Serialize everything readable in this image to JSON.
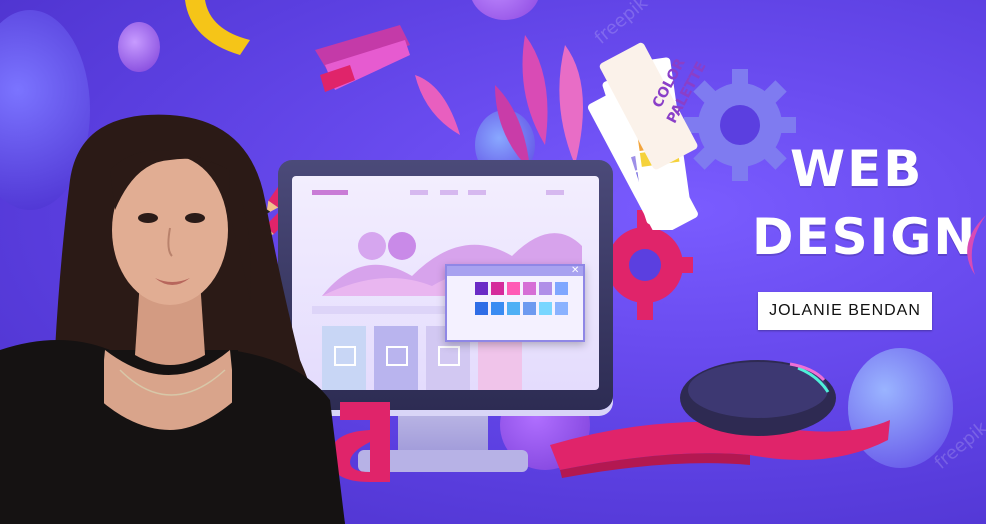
{
  "banner": {
    "title_line1": "WEB",
    "title_line2": "DESIGN",
    "author_name": "JOLANIE BENDAN"
  },
  "palette_card": {
    "text_line1": "COLOR",
    "text_line2": "PALETTE"
  },
  "watermark_text": "freepik",
  "colors": {
    "background": "#5b3fe0",
    "accent_pink": "#e0246a",
    "accent_yellow": "#f5c518",
    "accent_magenta": "#c43aa8",
    "light_blue": "#8fb4ff"
  },
  "swatches": [
    "#6a2bc6",
    "#d52b9b",
    "#ff5bb5",
    "#d66fd6",
    "#b08fe8",
    "#7fa7ff",
    "#2f6de6",
    "#3a8cf2",
    "#4fb0f5",
    "#6d9af0",
    "#78d6ff",
    "#8ab2ff"
  ]
}
